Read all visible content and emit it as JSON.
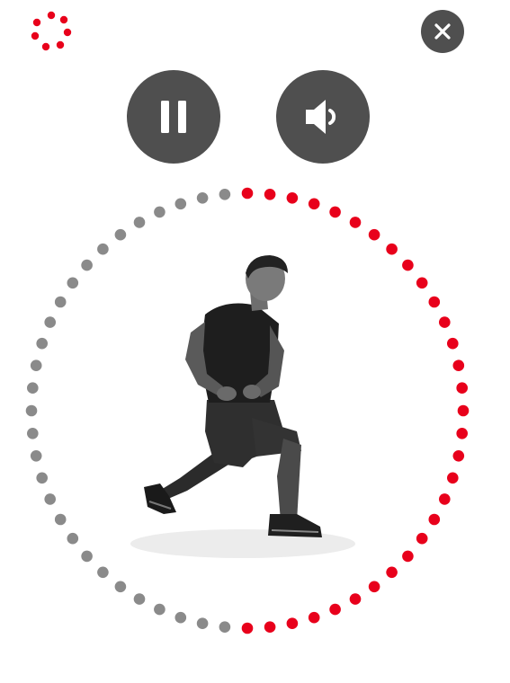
{
  "colors": {
    "accent": "#e8001b",
    "remaining": "#8a8a8a",
    "button_bg": "#4f4f4f",
    "button_icon": "#ffffff"
  },
  "icons": {
    "loading": "loading-spinner-icon",
    "close": "close-icon",
    "pause": "pause-icon",
    "sound": "speaker-icon",
    "exercise": "exercise-image-lunge"
  },
  "timer": {
    "total_dots": 60,
    "elapsed_dots": 30,
    "progress_fraction": 0.5
  }
}
